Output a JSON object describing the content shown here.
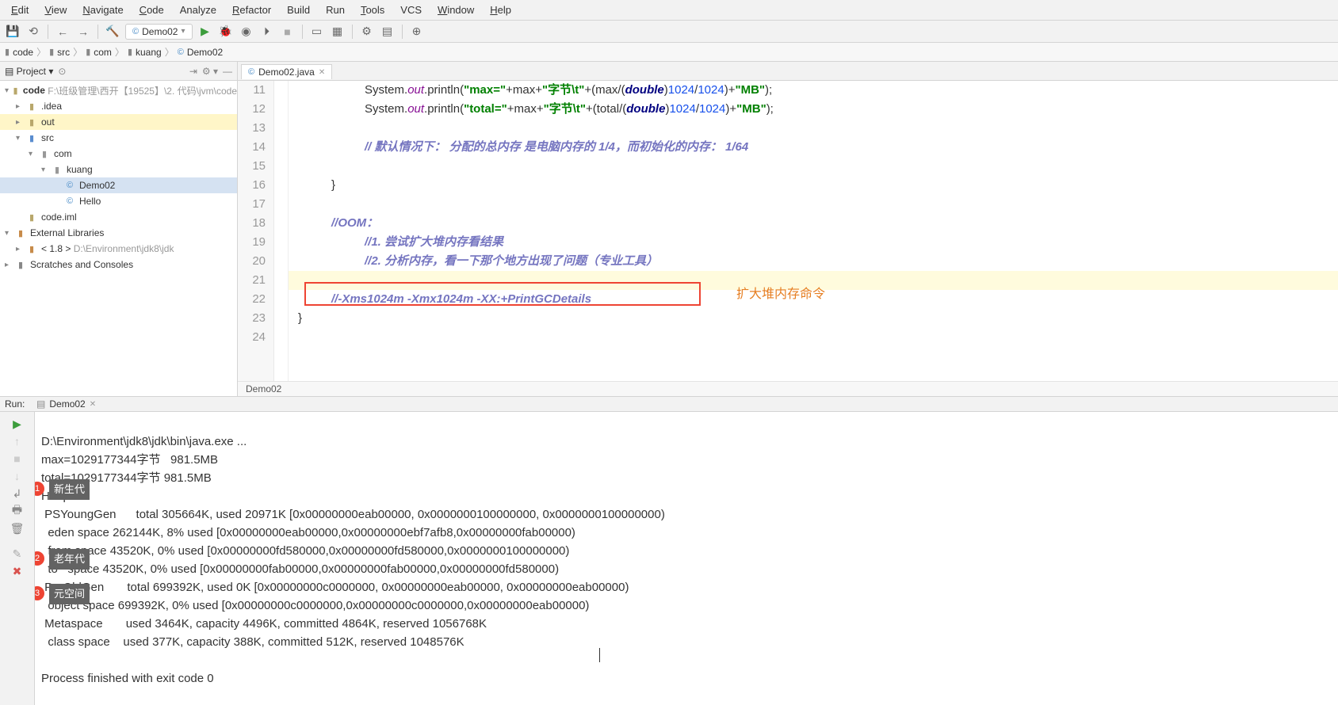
{
  "menu": {
    "edit": "Edit",
    "view": "View",
    "navigate": "Navigate",
    "code": "Code",
    "analyze": "Analyze",
    "refactor": "Refactor",
    "build": "Build",
    "run": "Run",
    "tools": "Tools",
    "vcs": "VCS",
    "window": "Window",
    "help": "Help"
  },
  "toolbar": {
    "run_config": "Demo02"
  },
  "breadcrumbs": {
    "b1": "code",
    "b2": "src",
    "b3": "com",
    "b4": "kuang",
    "b5": "Demo02"
  },
  "project": {
    "header": "Project",
    "root": "code",
    "root_path": "F:\\班级管理\\西开【19525】\\2. 代码\\jvm\\code",
    "idea": ".idea",
    "out": "out",
    "src": "src",
    "com": "com",
    "kuang": "kuang",
    "demo02": "Demo02",
    "hello": "Hello",
    "iml": "code.iml",
    "ext": "External Libraries",
    "jdk": "< 1.8 >",
    "jdk_path": "D:\\Environment\\jdk8\\jdk",
    "scratch": "Scratches and Consoles"
  },
  "editor": {
    "tab": "Demo02.java",
    "lines": {
      "l11": "11",
      "l12": "12",
      "l13": "13",
      "l14": "14",
      "l15": "15",
      "l16": "16",
      "l17": "17",
      "l18": "18",
      "l19": "19",
      "l20": "20",
      "l21": "21",
      "l22": "22",
      "l23": "23",
      "l24": "24"
    },
    "code11_a": "System.",
    "code11_b": "out",
    "code11_c": ".println(",
    "code11_d": "\"max=\"",
    "code11_e": "+max+",
    "code11_f": "\"字节\\t\"",
    "code11_g": "+(max/(",
    "code11_h": "double",
    "code11_i": ")",
    "code11_j": "1024",
    "code11_k": "/",
    "code11_l": "1024",
    "code11_m": ")+",
    "code11_n": "\"MB\"",
    "code11_o": ");",
    "code12_a": "System.",
    "code12_b": "out",
    "code12_c": ".println(",
    "code12_d": "\"total=\"",
    "code12_e": "+max+",
    "code12_f": "\"字节\\t\"",
    "code12_g": "+(total/(",
    "code12_h": "double",
    "code12_i": ")",
    "code12_j": "1024",
    "code12_k": "/",
    "code12_l": "1024",
    "code12_m": ")+",
    "code12_n": "\"MB\"",
    "code12_o": ");",
    "code14": "// 默认情况下：  分配的总内存 是电脑内存的 1/4，而初始化的内存：  1/64",
    "code16": "}",
    "code18": "//OOM：",
    "code19": "//1. 尝试扩大堆内存看结果",
    "code20": "//2. 分析内存，看一下那个地方出现了问题（专业工具）",
    "code22": "//-Xms1024m -Xmx1024m -XX:+PrintGCDetails",
    "code23": "}",
    "orange_label": "扩大堆内存命令",
    "crumb": "Demo02"
  },
  "run": {
    "header": "Run:",
    "tab": "Demo02",
    "line1": "D:\\Environment\\jdk8\\jdk\\bin\\java.exe ...",
    "line2": "max=1029177344字节   981.5MB",
    "line3": "total=1029177344字节 981.5MB",
    "line4": "Heap",
    "line5": " PSYoungGen      total 305664K, used 20971K [0x00000000eab00000, 0x0000000100000000, 0x0000000100000000)",
    "line6": "  eden space 262144K, 8% used [0x00000000eab00000,0x00000000ebf7afb8,0x00000000fab00000)",
    "line7": "  from space 43520K, 0% used [0x00000000fd580000,0x00000000fd580000,0x0000000100000000)",
    "line8": "  to   space 43520K, 0% used [0x00000000fab00000,0x00000000fab00000,0x00000000fd580000)",
    "line9": " ParOldGen       total 699392K, used 0K [0x00000000c0000000, 0x00000000eab00000, 0x00000000eab00000)",
    "line10": "  object space 699392K, 0% used [0x00000000c0000000,0x00000000c0000000,0x00000000eab00000)",
    "line11": " Metaspace       used 3464K, capacity 4496K, committed 4864K, reserved 1056768K",
    "line12": "  class space    used 377K, capacity 388K, committed 512K, reserved 1048576K",
    "line13": "",
    "line14": "Process finished with exit code 0",
    "badge1": "1",
    "badge2": "2",
    "badge3": "3",
    "label1": "新生代",
    "label2": "老年代",
    "label3": "元空间"
  }
}
